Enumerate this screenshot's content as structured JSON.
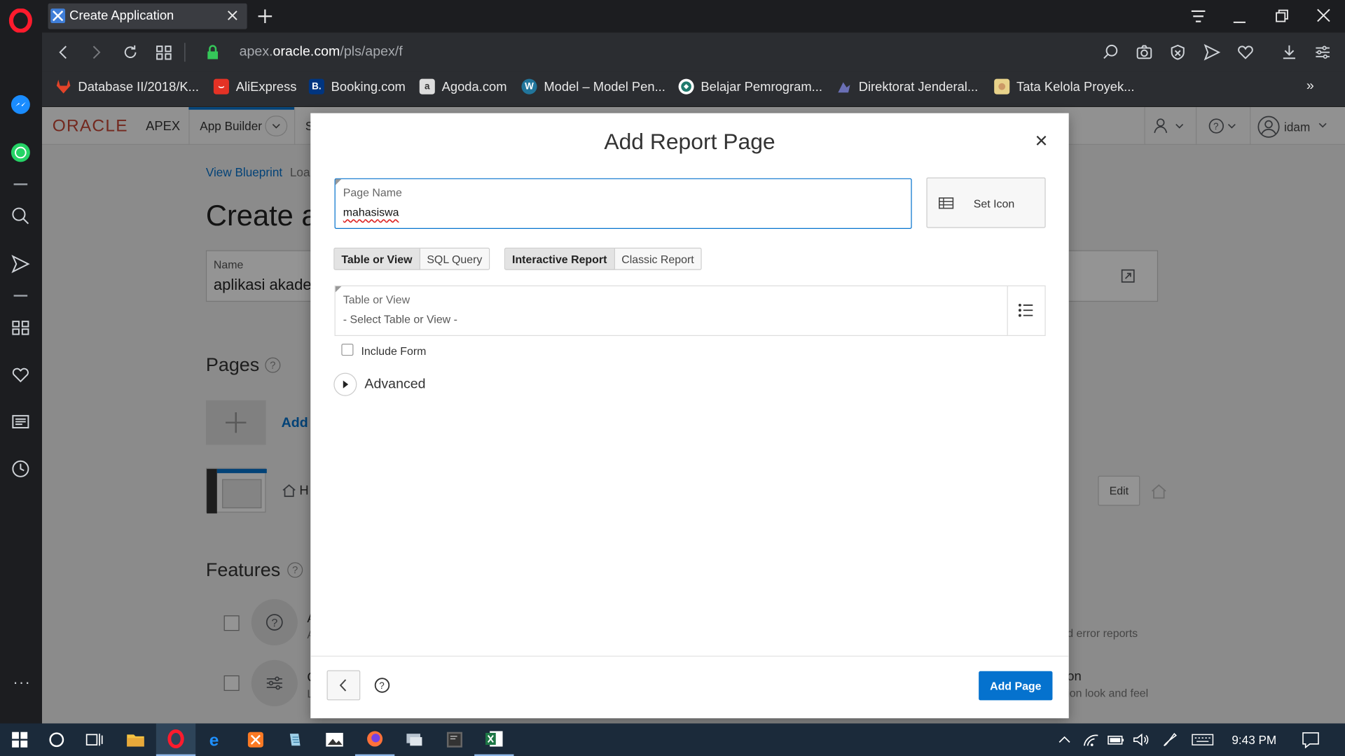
{
  "browser": {
    "tab_title": "Create Application",
    "url_prefix": "apex.",
    "url_domain": "oracle.com",
    "url_path": "/pls/apex/f",
    "bookmarks": [
      {
        "label": "Database II/2018/K...",
        "icon": "gitlab-icon",
        "color": "#e24329"
      },
      {
        "label": "AliExpress",
        "icon": "aliexpress-icon",
        "color": "#e43225"
      },
      {
        "label": "Booking.com",
        "icon": "booking-icon",
        "color": "#003580"
      },
      {
        "label": "Agoda.com",
        "icon": "agoda-icon",
        "color": "#dddddd"
      },
      {
        "label": "Model – Model Pen...",
        "icon": "wordpress-icon",
        "color": "#21759b"
      },
      {
        "label": "Belajar Pemrogram...",
        "icon": "globe-icon",
        "color": "#1f7a6d"
      },
      {
        "label": "Direktorat Jenderal...",
        "icon": "emblem-icon",
        "color": "#6a6fb5"
      },
      {
        "label": "Tata Kelola Proyek...",
        "icon": "doc-icon",
        "color": "#e8d28a"
      }
    ]
  },
  "apex": {
    "logo_oracle": "ORACLE",
    "logo_apex": "APEX",
    "menu_app_builder": "App Builder",
    "menu_next_initial": "S",
    "user": "idam",
    "breadcrumb_view_blueprint": "View Blueprint",
    "breadcrumb_load": "Loa",
    "page_title": "Create a",
    "name_label": "Name",
    "name_value": "aplikasi akader",
    "pages_heading": "Pages",
    "add_link": "Add",
    "home_item": "H",
    "edit_button": "Edit",
    "features_heading": "Features",
    "feature1_initial": "A",
    "feature1_sub": "A",
    "feature2_initial": "C",
    "feature2_sub": "L",
    "right_text1": "d error reports",
    "right_text2": "on",
    "right_text3": "ion look and feel"
  },
  "dialog": {
    "title": "Add Report Page",
    "page_name_label": "Page Name",
    "page_name_value": "mahasiswa",
    "set_icon_label": "Set Icon",
    "source_tabs": [
      {
        "label": "Table or View",
        "selected": true
      },
      {
        "label": "SQL Query",
        "selected": false
      }
    ],
    "report_tabs": [
      {
        "label": "Interactive Report",
        "selected": true
      },
      {
        "label": "Classic Report",
        "selected": false
      }
    ],
    "table_label": "Table or View",
    "table_placeholder": "- Select Table or View -",
    "include_form_label": "Include Form",
    "include_form_checked": false,
    "advanced_label": "Advanced",
    "add_page_button": "Add Page",
    "accent": "#0572ce"
  },
  "taskbar": {
    "time": "9:43 PM"
  }
}
